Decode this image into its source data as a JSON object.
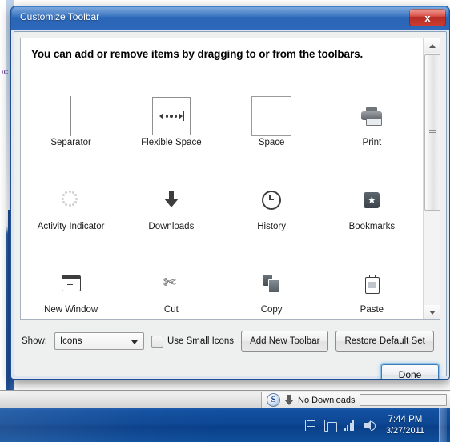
{
  "window": {
    "title": "Customize Toolbar",
    "close_label": "x"
  },
  "dialog": {
    "headline": "You can add or remove items by dragging to or from the toolbars.",
    "items": [
      {
        "label": "Separator",
        "icon": "separator-icon"
      },
      {
        "label": "Flexible Space",
        "icon": "flexible-space-icon"
      },
      {
        "label": "Space",
        "icon": "space-icon"
      },
      {
        "label": "Print",
        "icon": "printer-icon"
      },
      {
        "label": "Activity Indicator",
        "icon": "spinner-icon"
      },
      {
        "label": "Downloads",
        "icon": "download-arrow-icon"
      },
      {
        "label": "History",
        "icon": "clock-icon"
      },
      {
        "label": "Bookmarks",
        "icon": "star-icon"
      },
      {
        "label": "New Window",
        "icon": "new-window-icon"
      },
      {
        "label": "Cut",
        "icon": "scissors-icon"
      },
      {
        "label": "Copy",
        "icon": "copy-pages-icon"
      },
      {
        "label": "Paste",
        "icon": "clipboard-icon"
      }
    ],
    "controls": {
      "show_label": "Show:",
      "show_value": "Icons",
      "show_options": [
        "Icons"
      ],
      "small_icons_label": "Use Small Icons",
      "small_icons_checked": false,
      "add_toolbar_label": "Add New Toolbar",
      "restore_label": "Restore Default Set"
    },
    "done_label": "Done"
  },
  "statusbar": {
    "app_logo": "safari-logo-icon",
    "app_initial": "S",
    "downloads_icon": "download-arrow-icon",
    "downloads_text": "No Downloads"
  },
  "background": {
    "link_text": "oc"
  },
  "taskbar": {
    "tray_icons": [
      "flag-icon",
      "action-center-icon",
      "network-signal-icon",
      "volume-icon"
    ],
    "time": "7:44 PM",
    "date": "3/27/2011"
  },
  "colors": {
    "title_blue": "#2f6cbd",
    "close_red": "#d5463c",
    "taskbar_blue": "#0d4794",
    "focus_glow": "#6ab0e6",
    "link_purple": "#5b2a8c"
  }
}
